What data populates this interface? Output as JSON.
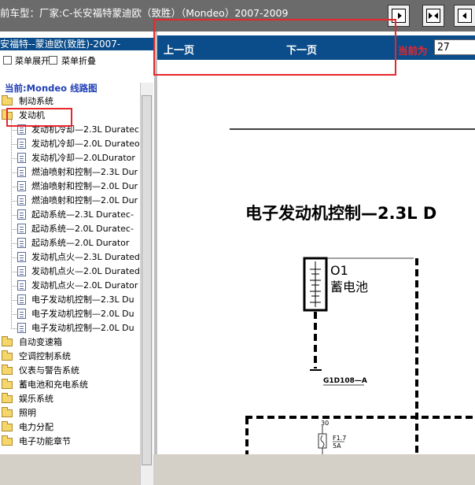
{
  "window": {
    "title": "前车型：厂家:C-长安福特蒙迪欧（致胜）（Mondeo）2007-2009",
    "toolbar_icons": [
      "collapse-left-icon",
      "split-icon",
      "collapse-right-icon"
    ]
  },
  "left": {
    "header": "安福特--蒙迪欧(致胜)-2007-",
    "expand_label": "菜单展开",
    "collapse_label": "菜单折叠",
    "current_label": "当前:Mondeo 线路图",
    "tree": [
      {
        "label": "制动系统",
        "type": "folder"
      },
      {
        "label": "发动机",
        "type": "folder-open"
      },
      {
        "label": "发动机冷却—2.3L Duratec",
        "type": "doc"
      },
      {
        "label": "发动机冷却—2.0L Durateo",
        "type": "doc"
      },
      {
        "label": "发动机冷却—2.0LDurator",
        "type": "doc"
      },
      {
        "label": "燃油喷射和控制—2.3L Dur",
        "type": "doc"
      },
      {
        "label": "燃油喷射和控制—2.0L Dur",
        "type": "doc"
      },
      {
        "label": "燃油喷射和控制—2.0L Dur",
        "type": "doc"
      },
      {
        "label": "起动系统—2.3L Duratec-",
        "type": "doc"
      },
      {
        "label": "起动系统—2.0L Duratec-",
        "type": "doc"
      },
      {
        "label": "起动系统—2.0L Durator",
        "type": "doc"
      },
      {
        "label": "发动机点火—2.3L Durated",
        "type": "doc"
      },
      {
        "label": "发动机点火—2.0L Durated",
        "type": "doc"
      },
      {
        "label": "发动机点火—2.0L Durator",
        "type": "doc"
      },
      {
        "label": "电子发动机控制—2.3L Du",
        "type": "doc",
        "selected": true
      },
      {
        "label": "电子发动机控制—2.0L Du",
        "type": "doc"
      },
      {
        "label": "电子发动机控制—2.0L Du",
        "type": "doc"
      },
      {
        "label": "自动变速箱",
        "type": "folder"
      },
      {
        "label": "空调控制系统",
        "type": "folder"
      },
      {
        "label": "仪表与警告系统",
        "type": "folder"
      },
      {
        "label": "蓄电池和充电系统",
        "type": "folder"
      },
      {
        "label": "娱乐系统",
        "type": "folder"
      },
      {
        "label": "照明",
        "type": "folder"
      },
      {
        "label": "电力分配",
        "type": "folder"
      },
      {
        "label": "电子功能章节",
        "type": "folder"
      }
    ]
  },
  "nav": {
    "prev_label": "上一页",
    "next_label": "下一页",
    "current_page_label": "当前为",
    "current_page_value": "27"
  },
  "diagram": {
    "title": "电子发动机控制—2.3L D",
    "component_id": "O1",
    "component_name": "蓄电池",
    "ground_label": "G1D108—A",
    "fuse_pin": "30",
    "fuse_id": "F1.7",
    "fuse_rating": "5A"
  }
}
